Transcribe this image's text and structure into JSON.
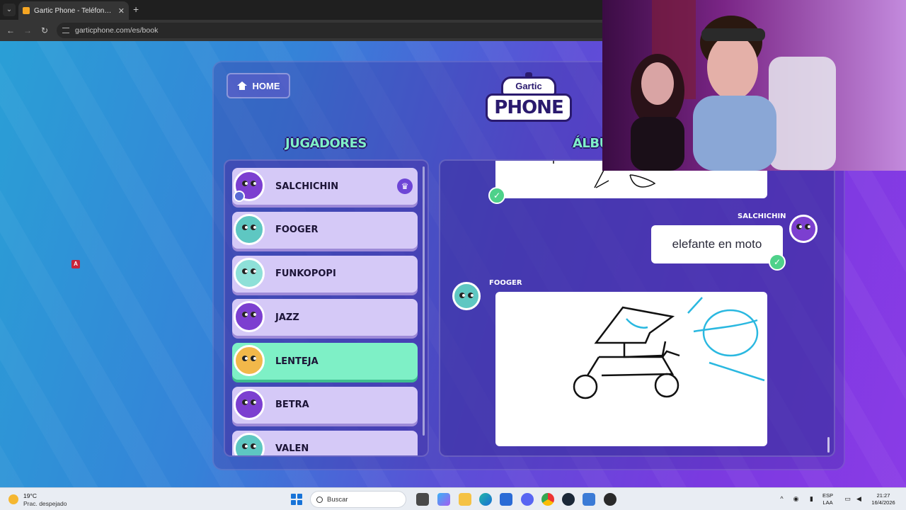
{
  "browser": {
    "tab_title": "Gartic Phone - Teléfono Descon...",
    "tab_close": "✕",
    "new_tab": "+",
    "tab_list": "⌄",
    "back": "←",
    "forward": "→",
    "reload": "↻",
    "url": "garticphone.com/es/book"
  },
  "page": {
    "badge": "A",
    "home_label": "HOME",
    "logo_top": "Gartic",
    "logo_bottom": "PHONE",
    "players_title": "JUGADORES",
    "album_title": "ÁLBUM"
  },
  "players": [
    {
      "name": "SALCHICHIN",
      "owner": true,
      "color": "#7c3fd0"
    },
    {
      "name": "FOOGER",
      "owner": false,
      "color": "#5ec7c2"
    },
    {
      "name": "FUNKOPOPI",
      "owner": false,
      "color": "#8ee0d8"
    },
    {
      "name": "JAZZ",
      "owner": false,
      "color": "#7c3fd0"
    },
    {
      "name": "LENTEJA",
      "owner": false,
      "color": "#f2b84a",
      "highlight": true
    },
    {
      "name": "BETRA",
      "owner": false,
      "color": "#7c3fd0"
    },
    {
      "name": "VALEN",
      "owner": false,
      "color": "#5ec7c2"
    }
  ],
  "album": {
    "author_1": "SALCHICHIN",
    "message_1": "elefante en moto",
    "author_2": "FOOGER",
    "check": "✓",
    "crown": "♛"
  },
  "taskbar": {
    "temp": "19°C",
    "weather": "Prac. despejado",
    "search_placeholder": "Buscar",
    "lang_1": "ESP",
    "lang_2": "LAA",
    "time": "21:27",
    "date": "16/4/2026"
  },
  "colors": {
    "accent_green": "#7ef0c6",
    "player_card": "#d5c9f7",
    "check_green": "#4ed18a"
  }
}
